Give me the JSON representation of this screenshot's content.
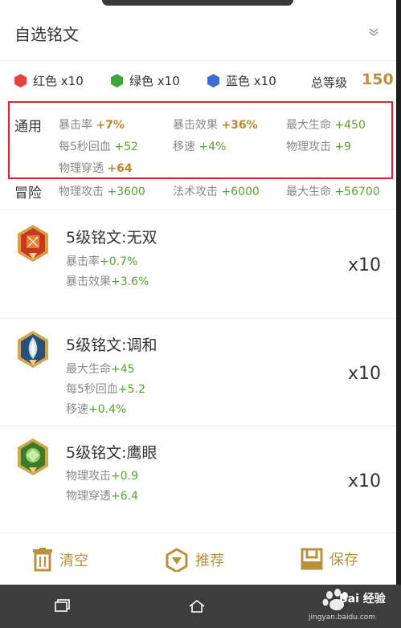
{
  "header": {
    "title": "自选铭文"
  },
  "gems": [
    {
      "label": "红色 x10",
      "color": "#e0443a"
    },
    {
      "label": "绿色 x10",
      "color": "#3fa43c"
    },
    {
      "label": "蓝色 x10",
      "color": "#3c6fd0"
    }
  ],
  "level": {
    "label": "总等级",
    "value": "150"
  },
  "general": {
    "label": "通用",
    "attrs": [
      {
        "name": "暴击率",
        "value": "+7%"
      },
      {
        "name": "暴击效果",
        "value": "+36%"
      },
      {
        "name": "最大生命",
        "value": "+450"
      },
      {
        "name": "每5秒回血",
        "value": "+52"
      },
      {
        "name": "移速",
        "value": "+4%"
      },
      {
        "name": "物理攻击",
        "value": "+9"
      },
      {
        "name": "物理穿透",
        "value": "+64"
      }
    ]
  },
  "adventure": {
    "label": "冒险",
    "attrs": [
      {
        "name": "物理攻击",
        "value": "+3600"
      },
      {
        "name": "法术攻击",
        "value": "+6000"
      },
      {
        "name": "最大生命",
        "value": "+56700"
      }
    ]
  },
  "runes": [
    {
      "name": "5级铭文:无双",
      "count": "x10",
      "attrs": [
        {
          "name": "暴击率",
          "value": "+0.7%"
        },
        {
          "name": "暴击效果",
          "value": "+3.6%"
        }
      ]
    },
    {
      "name": "5级铭文:调和",
      "count": "x10",
      "attrs": [
        {
          "name": "最大生命",
          "value": "+45"
        },
        {
          "name": "每5秒回血",
          "value": "+5.2"
        },
        {
          "name": "移速",
          "value": "+0.4%"
        }
      ]
    },
    {
      "name": "5级铭文:鹰眼",
      "count": "x10",
      "attrs": [
        {
          "name": "物理攻击",
          "value": "+0.9"
        },
        {
          "name": "物理穿透",
          "value": "+6.4"
        }
      ]
    }
  ],
  "bottom": {
    "clear": "清空",
    "recommend": "推荐",
    "save": "保存"
  },
  "watermark": {
    "text": "Bai 经验",
    "url": "jingyan.baidu.com"
  }
}
